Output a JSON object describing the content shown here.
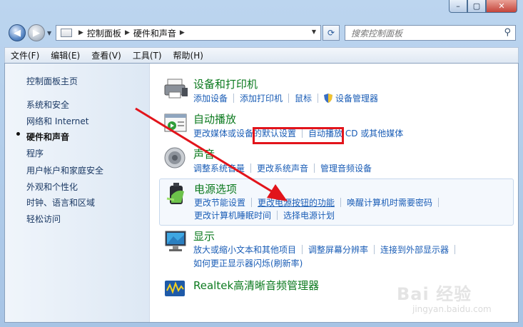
{
  "window": {
    "controls": {
      "minimize": "–",
      "maximize": "▢",
      "close": "✕"
    },
    "back_icon": "◀",
    "forward_icon": "▶",
    "nav_dropdown_icon": "▼"
  },
  "address": {
    "crumbs": [
      "控制面板",
      "硬件和声音"
    ],
    "separator": "▶",
    "dropdown": "▼",
    "refresh_icon": "⟳"
  },
  "search": {
    "placeholder": "搜索控制面板",
    "icon": "⚲"
  },
  "menu": [
    "文件(F)",
    "编辑(E)",
    "查看(V)",
    "工具(T)",
    "帮助(H)"
  ],
  "sidebar": {
    "home": "控制面板主页",
    "items": [
      "系统和安全",
      "网络和 Internet",
      "硬件和声音",
      "程序",
      "用户帐户和家庭安全",
      "外观和个性化",
      "时钟、语言和区域",
      "轻松访问"
    ],
    "active_index": 2
  },
  "categories": [
    {
      "title": "设备和打印机",
      "icon": "printer-icon",
      "rows": [
        [
          "添加设备",
          "添加打印机",
          "鼠标",
          "设备管理器"
        ]
      ]
    },
    {
      "title": "自动播放",
      "icon": "autoplay-icon",
      "rows": [
        [
          "更改媒体或设备的默认设置",
          "自动播放 CD 或其他媒体"
        ]
      ]
    },
    {
      "title": "声音",
      "icon": "speaker-icon",
      "rows": [
        [
          "调整系统音量",
          "更改系统声音",
          "管理音频设备"
        ]
      ]
    },
    {
      "title": "电源选项",
      "icon": "battery-icon",
      "rows": [
        [
          "更改节能设置",
          "更改电源按钮的功能",
          "唤醒计算机时需要密码"
        ],
        [
          "更改计算机睡眠时间",
          "选择电源计划"
        ]
      ]
    },
    {
      "title": "显示",
      "icon": "monitor-icon",
      "rows": [
        [
          "放大或缩小文本和其他项目",
          "调整屏幕分辨率",
          "连接到外部显示器"
        ],
        [
          "如何更正显示器闪烁(刷新率)"
        ]
      ]
    },
    {
      "title": "Realtek高清晰音频管理器",
      "icon": "realtek-icon",
      "rows": []
    }
  ],
  "annotation": {
    "highlight_color": "#e2141b"
  },
  "watermark": {
    "brand": "Bai 经验",
    "url": "jingyan.baidu.com"
  }
}
